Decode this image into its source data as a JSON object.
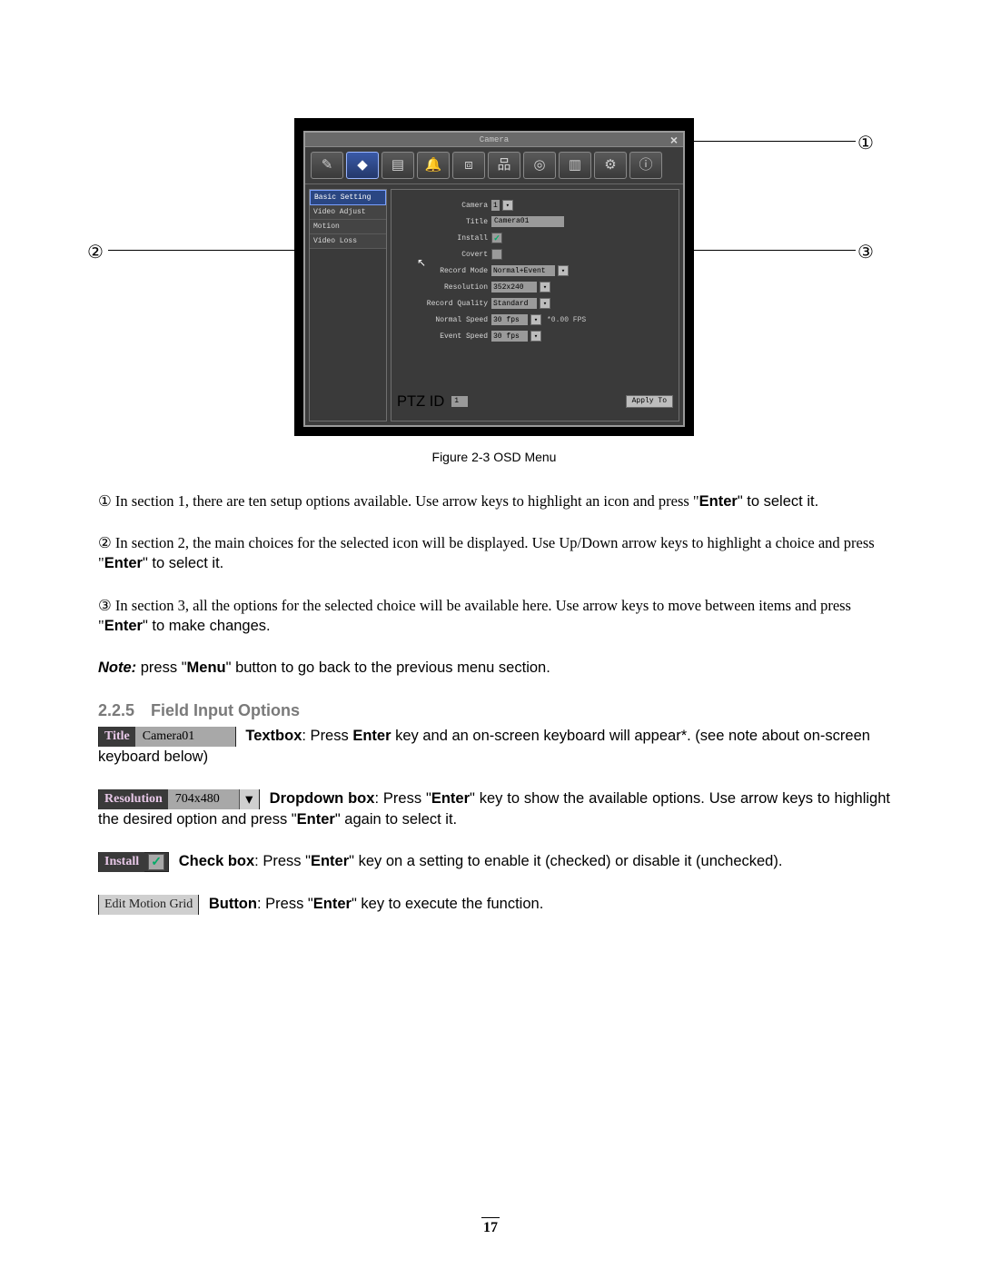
{
  "figure": {
    "window_title": "Camera",
    "callouts": {
      "c1": "①",
      "c2": "②",
      "c3": "③"
    },
    "toolbar_icons": [
      "✎",
      "◆",
      "▤",
      "🔔",
      "⧈",
      "品",
      "◎",
      "▥",
      "⚙",
      "ⓘ"
    ],
    "sidebar": [
      "Basic Setting",
      "Video Adjust",
      "Motion",
      "Video Loss"
    ],
    "fields": {
      "camera_label": "Camera",
      "camera_value": "1",
      "title_label": "Title",
      "title_value": "Camera01",
      "install_label": "Install",
      "covert_label": "Covert",
      "recmode_label": "Record Mode",
      "recmode_value": "Normal+Event",
      "resolution_label": "Resolution",
      "resolution_value": "352x240",
      "recqual_label": "Record Quality",
      "recqual_value": "Standard",
      "nspeed_label": "Normal Speed",
      "nspeed_value": "30 fps",
      "fps_extra": "*0.00 FPS",
      "espeed_label": "Event Speed",
      "espeed_value": "30 fps",
      "ptz_label": "PTZ ID",
      "ptz_value": "1",
      "apply_btn": "Apply To"
    },
    "caption": "Figure 2-3 OSD Menu"
  },
  "body": {
    "p1a": "① In section 1, there are ten setup options available. Use arrow keys to highlight an icon and press \"",
    "p1b": "\" to select it.",
    "p2a": "② In section 2, the main choices for the selected icon will be displayed. Use Up/Down arrow keys to highlight a choice and press \"",
    "p2b": "\" to select it.",
    "p3a": "③ In section 3, all the options for the selected choice will be available here. Use arrow keys to move between items and press \"",
    "p3b": "\" to make changes.",
    "note_lead": "Note:",
    "note_a": " press \"",
    "note_b": "\" button to go back to the previous menu section.",
    "enter": "Enter",
    "menu": "Menu"
  },
  "section": {
    "num": "2.2.5",
    "title": "Field Input Options"
  },
  "chips": {
    "textbox_label": "Title",
    "textbox_value": "Camera01",
    "dropdown_label": "Resolution",
    "dropdown_value": "704x480",
    "checkbox_label": "Install",
    "button_label": "Edit Motion Grid"
  },
  "desc": {
    "textbox_name": "Textbox",
    "textbox_a": ": Press ",
    "textbox_b": " key and an on-screen keyboard will appear*. (see note about on-screen keyboard below)",
    "dropdown_name": "Dropdown box",
    "dropdown_a": ": Press \"",
    "dropdown_b": "\" key to show the available options. Use arrow keys to highlight the desired option and press \"",
    "dropdown_c": "\" again to select it.",
    "checkbox_name": "Check box",
    "checkbox_a": ": Press \"",
    "checkbox_b": "\" key on a setting to enable it (checked) or disable it (unchecked).",
    "button_name": "Button",
    "button_a": ": Press \"",
    "button_b": "\" key to execute the function."
  },
  "page_number": "17"
}
